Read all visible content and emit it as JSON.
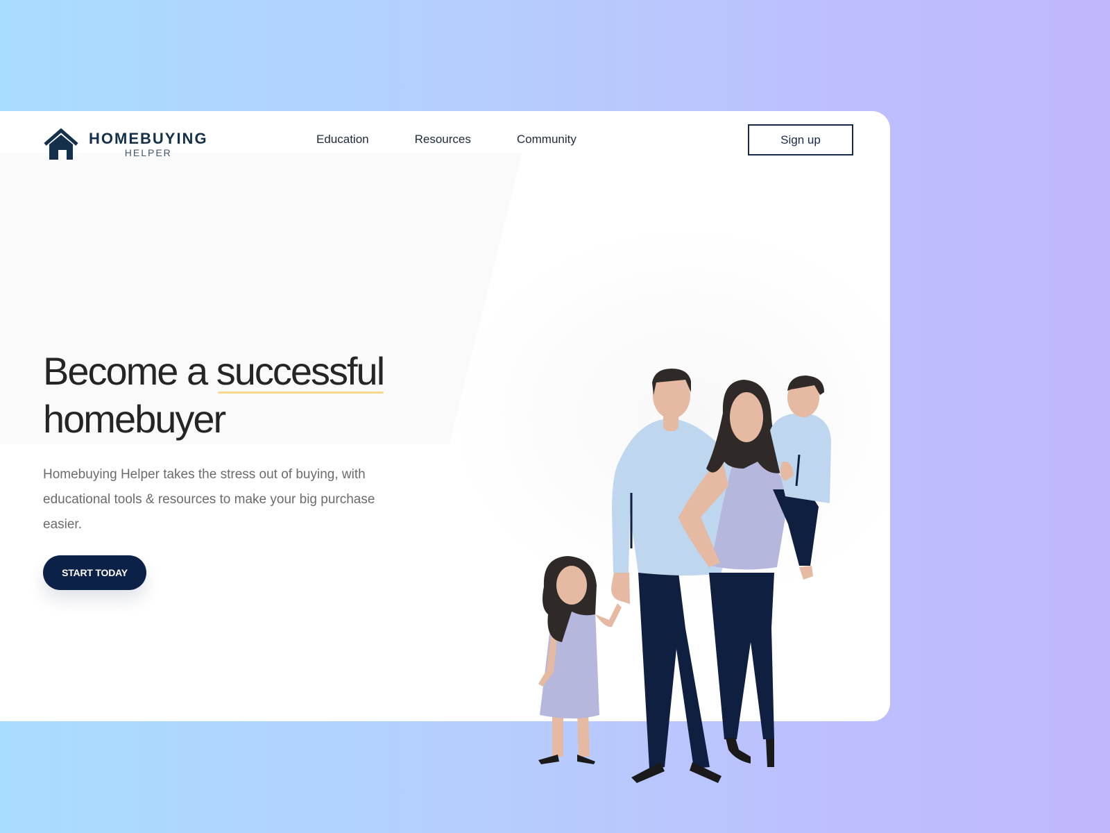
{
  "brand": {
    "name": "HOMEBUYING",
    "sub": "HELPER",
    "logo_icon": "house-icon",
    "color": "#14304a"
  },
  "nav": {
    "items": [
      {
        "label": "Education"
      },
      {
        "label": "Resources"
      },
      {
        "label": "Community"
      }
    ]
  },
  "header": {
    "signup_label": "Sign up"
  },
  "hero": {
    "headline_part1": "Become a ",
    "headline_highlight": "successful",
    "headline_part2": "homebuyer",
    "description": "Homebuying Helper takes the stress out of buying, with educational tools & resources to make your big purchase easier.",
    "cta_label": "START TODAY"
  },
  "colors": {
    "accent_navy": "#0c2148",
    "highlight_yellow": "#fbd98a",
    "shirt_blue": "#bed6ee",
    "dress_lavender": "#b6b7dc",
    "skin": "#e5b9a2",
    "hair": "#2f2a28"
  },
  "illustration": {
    "name": "family-illustration"
  }
}
